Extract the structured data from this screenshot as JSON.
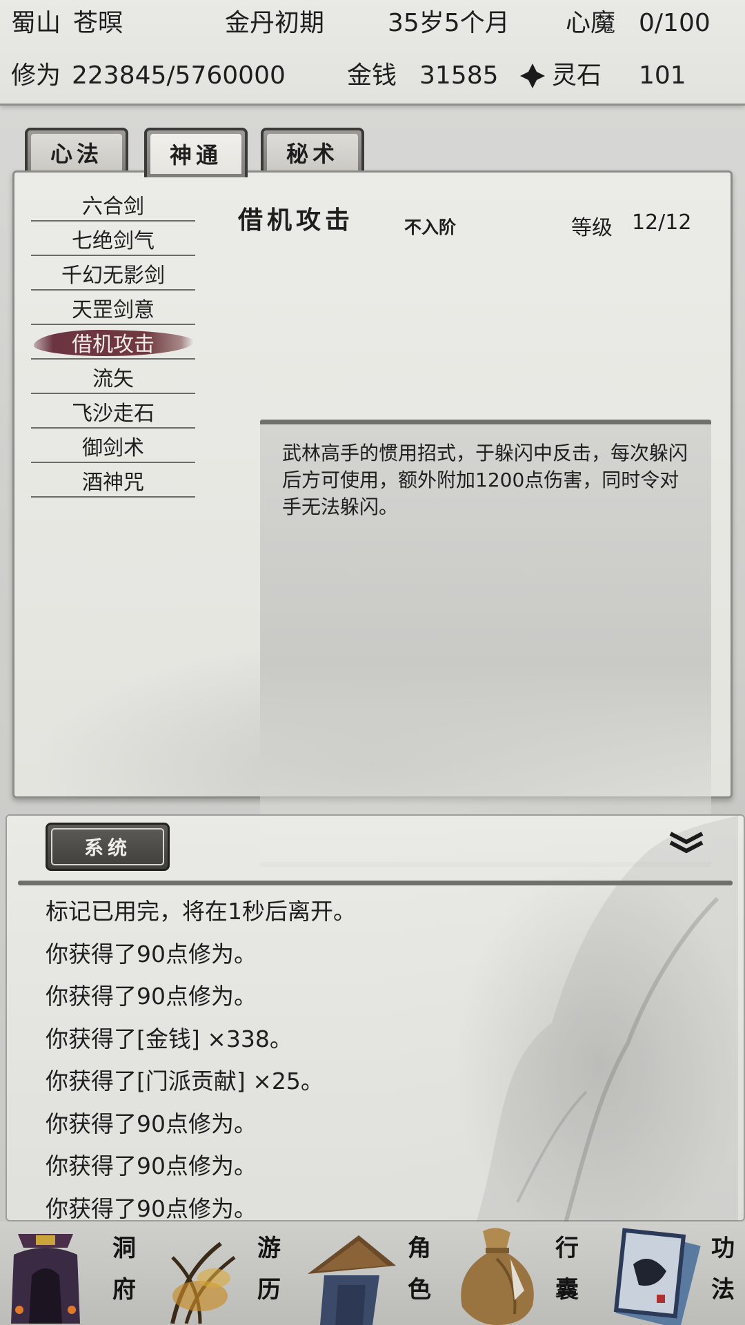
{
  "status": {
    "sect": "蜀山",
    "name": "苍暝",
    "realm": "金丹初期",
    "age": "35岁5个月",
    "heart_demon_label": "心魔",
    "heart_demon_value": "0/100",
    "cultivation_label": "修为",
    "cultivation_value": "223845/5760000",
    "money_label": "金钱",
    "money_value": "31585",
    "spirit_stone_label": "灵石",
    "spirit_stone_value": "101"
  },
  "tabs": [
    {
      "label": "心法",
      "active": false
    },
    {
      "label": "神通",
      "active": true
    },
    {
      "label": "秘术",
      "active": false
    }
  ],
  "skills": [
    "六合剑",
    "七绝剑气",
    "千幻无影剑",
    "天罡剑意",
    "借机攻击",
    "流矢",
    "飞沙走石",
    "御剑术",
    "酒神咒"
  ],
  "selected_skill_index": 4,
  "detail": {
    "title": "借机攻击",
    "rank": "不入阶",
    "level_label": "等级",
    "level_value": "12/12",
    "description": "武林高手的惯用招式，于躲闪中反击，每次躲闪后方可使用，额外附加1200点伤害，同时令对手无法躲闪。"
  },
  "log": {
    "tab_label": "系统",
    "collapse_icon": "double-chevron-down-icon",
    "lines": [
      "标记已用完，将在1秒后离开。",
      "你获得了90点修为。",
      "你获得了90点修为。",
      "你获得了[金钱] ×338。",
      "你获得了[门派贡献] ×25。",
      "你获得了90点修为。",
      "你获得了90点修为。",
      "你获得了90点修为。"
    ]
  },
  "nav": [
    {
      "label": "洞府",
      "chars": [
        "洞",
        "府"
      ],
      "icon": "cave-dwelling-icon"
    },
    {
      "label": "游历",
      "chars": [
        "游",
        "历"
      ],
      "icon": "travel-reeds-icon"
    },
    {
      "label": "角色",
      "chars": [
        "角",
        "色"
      ],
      "icon": "character-straw-hat-icon"
    },
    {
      "label": "行囊",
      "chars": [
        "行",
        "囊"
      ],
      "icon": "pouch-bag-icon"
    },
    {
      "label": "功法",
      "chars": [
        "功",
        "法"
      ],
      "icon": "scroll-book-icon"
    }
  ],
  "colors": {
    "selected_brush": "#6b3440",
    "tab_frame": "#3b3a38",
    "panel_bg": "#e9e9e5"
  }
}
